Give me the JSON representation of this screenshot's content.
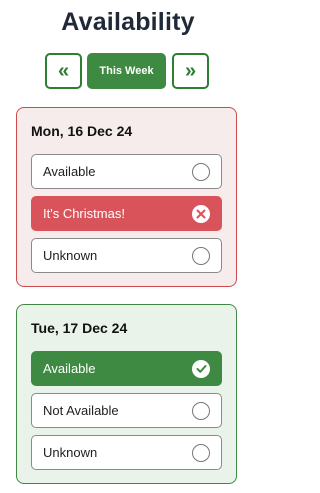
{
  "page": {
    "title": "Availability"
  },
  "week_nav": {
    "prev_label": "«",
    "this_week_label": "This Week",
    "next_label": "»"
  },
  "days": [
    {
      "title": "Mon, 16 Dec 24",
      "accent_color": "#cc4b4e",
      "options": [
        {
          "label": "Available",
          "selected": false
        },
        {
          "label": "It's Christmas!",
          "selected": true,
          "icon": "x-circle-icon"
        },
        {
          "label": "Unknown",
          "selected": false
        }
      ]
    },
    {
      "title": "Tue, 17 Dec 24",
      "accent_color": "#3f8a43",
      "options": [
        {
          "label": "Available",
          "selected": true,
          "icon": "check-circle-icon"
        },
        {
          "label": "Not Available",
          "selected": false
        },
        {
          "label": "Unknown",
          "selected": false
        }
      ]
    }
  ]
}
